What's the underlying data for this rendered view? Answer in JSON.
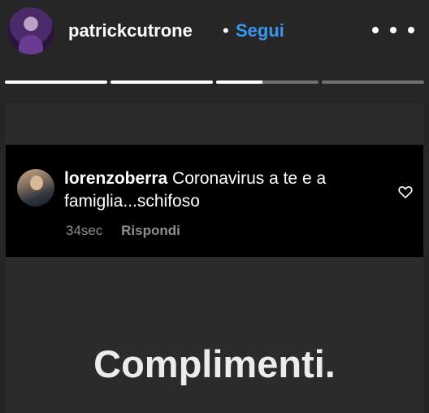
{
  "header": {
    "username": "patrickcutrone",
    "separator": "•",
    "follow_label": "Segui",
    "more_icon": "more-horizontal-icon"
  },
  "progress": {
    "segments": [
      1,
      1,
      0.45,
      0
    ]
  },
  "comment": {
    "username": "lorenzoberra",
    "text": " Coronavirus a te e a famiglia...schifoso",
    "time": "34sec",
    "reply_label": "Rispondi",
    "like_icon": "heart-outline-icon"
  },
  "story": {
    "caption": "Complimenti."
  },
  "colors": {
    "background": "#262626",
    "accent": "#3897f0",
    "comment_card": "#000000",
    "muted_text": "#8e8e8e"
  }
}
